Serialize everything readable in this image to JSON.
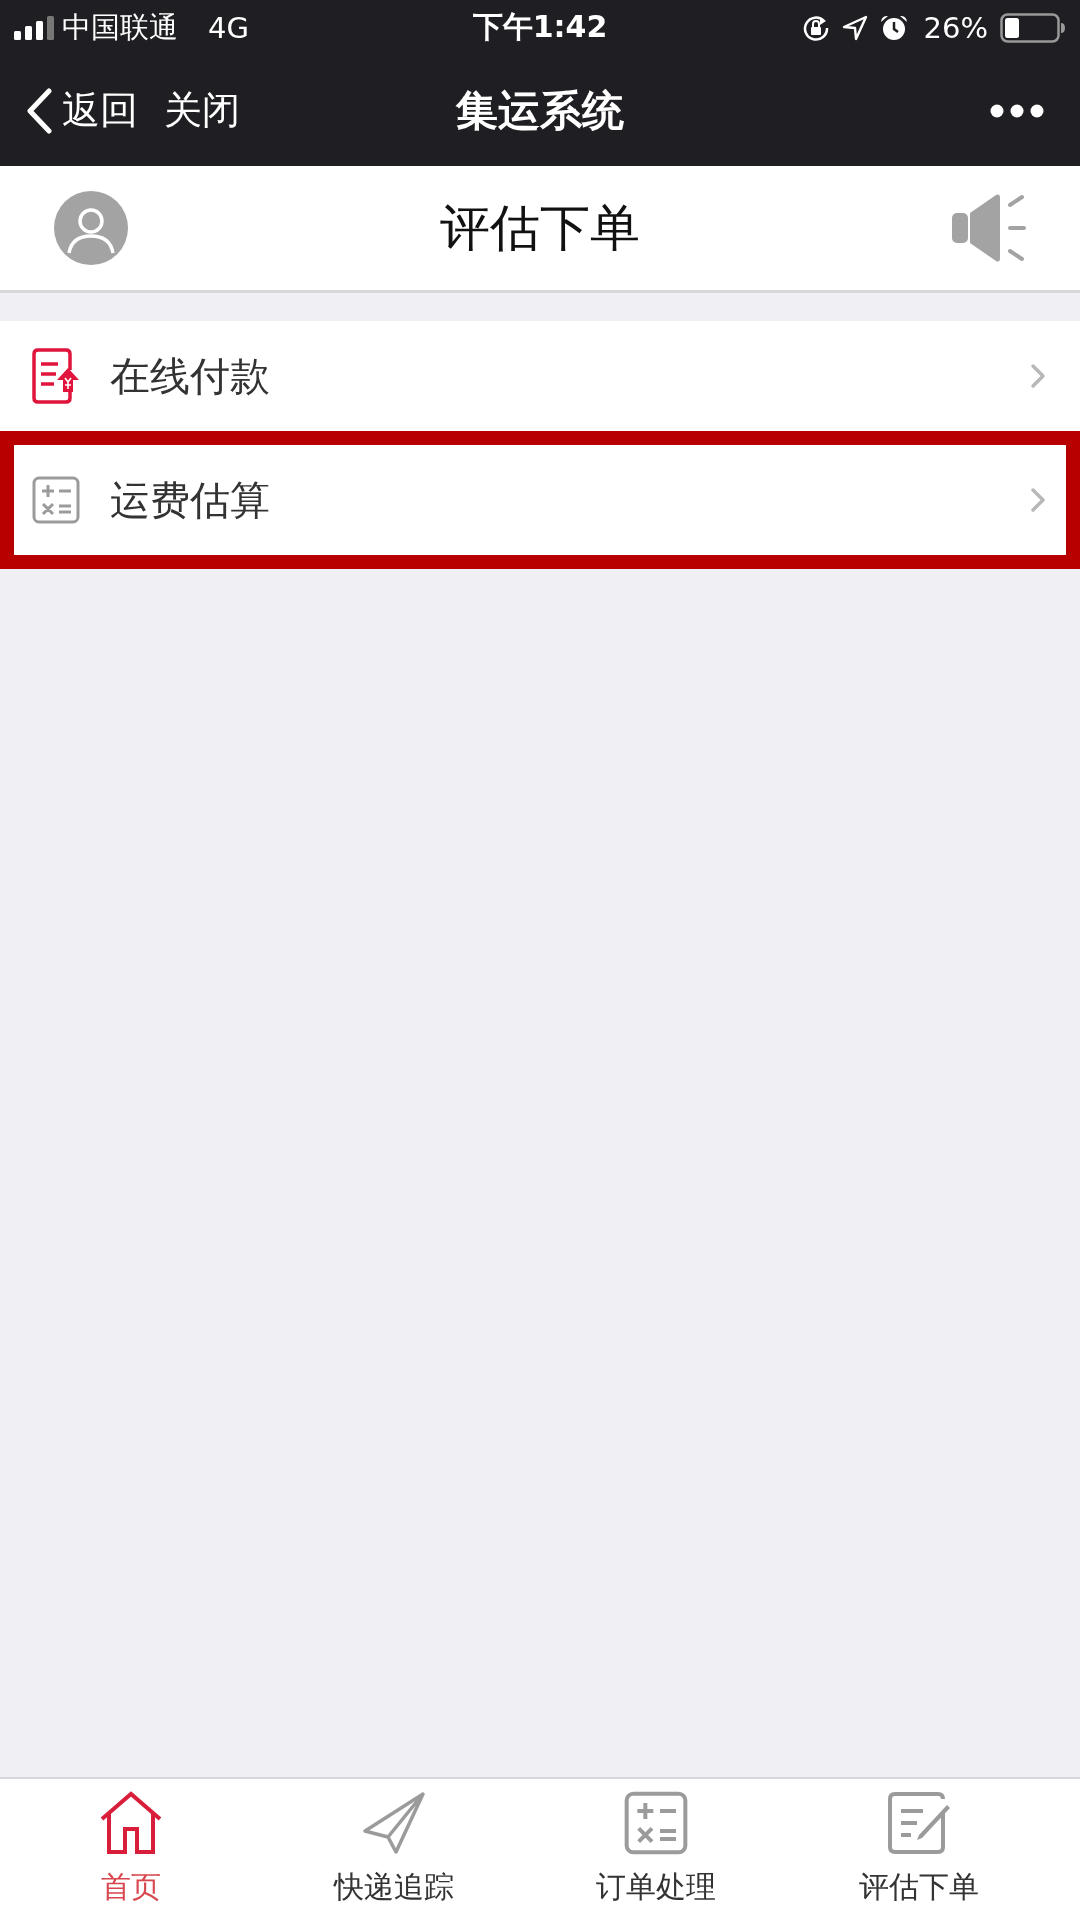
{
  "status_bar": {
    "carrier": "中国联通",
    "network": "4G",
    "time": "下午1:42",
    "battery_text": "26%"
  },
  "nav_bar": {
    "back": "返回",
    "close": "关闭",
    "title": "集运系统"
  },
  "header": {
    "title": "评估下单"
  },
  "menu": [
    {
      "label": "在线付款",
      "kind": "payment",
      "highlighted": false
    },
    {
      "label": "运费估算",
      "kind": "calculator",
      "highlighted": true
    }
  ],
  "tab_bar": [
    {
      "label": "首页",
      "kind": "home",
      "selected": true
    },
    {
      "label": "快递追踪",
      "kind": "plane",
      "selected": false
    },
    {
      "label": "订单处理",
      "kind": "calculator",
      "selected": false
    },
    {
      "label": "评估下单",
      "kind": "form",
      "selected": false
    }
  ]
}
